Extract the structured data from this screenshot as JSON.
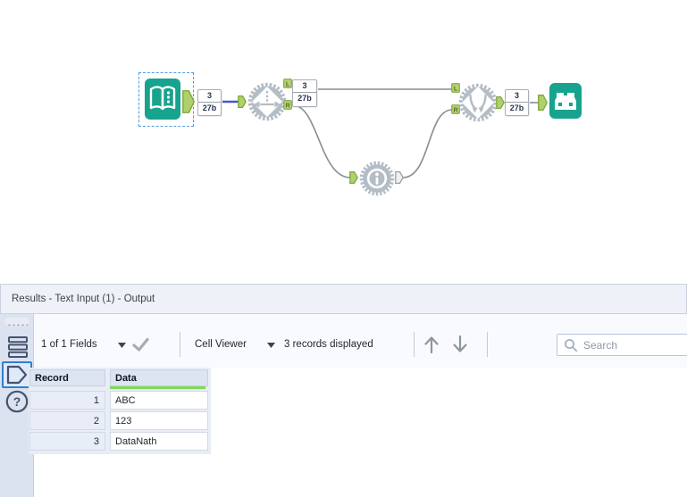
{
  "colors": {
    "tool_teal": "#17a38d",
    "macro_gear_gray": "#b4bdc6",
    "anchor_green": "#b0d169",
    "anchor_green_border": "#7fa844",
    "connection_gray": "#868d94",
    "selected_connection_blue": "#4655cf",
    "selection_dash_blue": "#4f9bdb",
    "data_column_underline_green": "#7fd957",
    "sidebar_selected_border_blue": "#2e7ed5"
  },
  "canvas": {
    "tools": [
      {
        "name": "Text Input",
        "state": "selected"
      },
      {
        "name": "macro-split-gear"
      },
      {
        "name": "macro-info-gear"
      },
      {
        "name": "macro-union-gear"
      },
      {
        "name": "Browse"
      }
    ],
    "anchor_labels": {
      "left": "L",
      "right": "R"
    },
    "annotations": [
      {
        "count": "3",
        "size": "27b"
      },
      {
        "count": "3",
        "size": "27b"
      },
      {
        "count": "3",
        "size": "27b"
      }
    ]
  },
  "icons": {
    "help_glyph": "?"
  },
  "results": {
    "title": "Results - Text Input (1) - Output",
    "toolbar": {
      "fields_summary": "1 of 1 Fields",
      "cell_viewer": "Cell Viewer",
      "records_displayed": "3 records displayed",
      "search_placeholder": "Search"
    },
    "table": {
      "columns": [
        "Record",
        "Data"
      ],
      "rows": [
        {
          "record": "1",
          "data": "ABC"
        },
        {
          "record": "2",
          "data": "123"
        },
        {
          "record": "3",
          "data": "DataNath"
        }
      ]
    }
  }
}
